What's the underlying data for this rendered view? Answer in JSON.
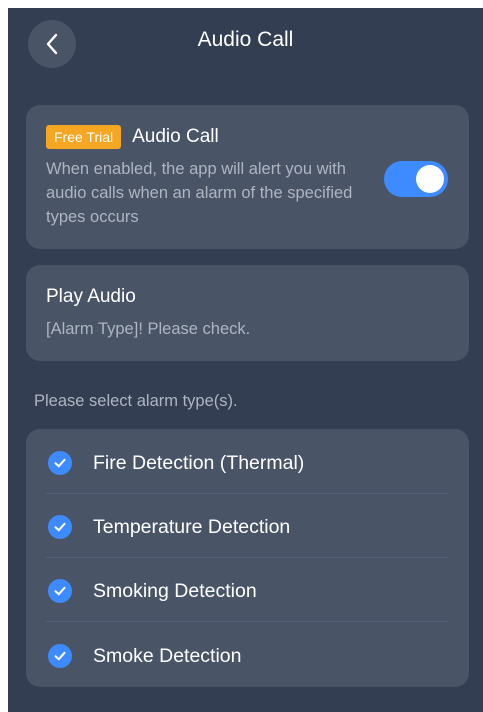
{
  "header": {
    "title": "Audio Call",
    "back_icon": "chevron-left-icon"
  },
  "audio_call_card": {
    "badge": "Free Trial",
    "title": "Audio Call",
    "description": "When enabled, the app will alert you with audio calls when an alarm of the specified types occurs",
    "toggle_on": true
  },
  "play_audio_card": {
    "title": "Play Audio",
    "message": "[Alarm Type]! Please check."
  },
  "alarm_section": {
    "label": "Please select alarm type(s).",
    "items": [
      {
        "label": "Fire Detection (Thermal)",
        "checked": true
      },
      {
        "label": "Temperature Detection",
        "checked": true
      },
      {
        "label": "Smoking Detection",
        "checked": true
      },
      {
        "label": "Smoke Detection",
        "checked": true
      }
    ]
  },
  "colors": {
    "background": "#333e52",
    "card": "#4a5467",
    "accent": "#3d8bff",
    "badge": "#f5a623",
    "secondary_text": "#aeb5c1"
  }
}
